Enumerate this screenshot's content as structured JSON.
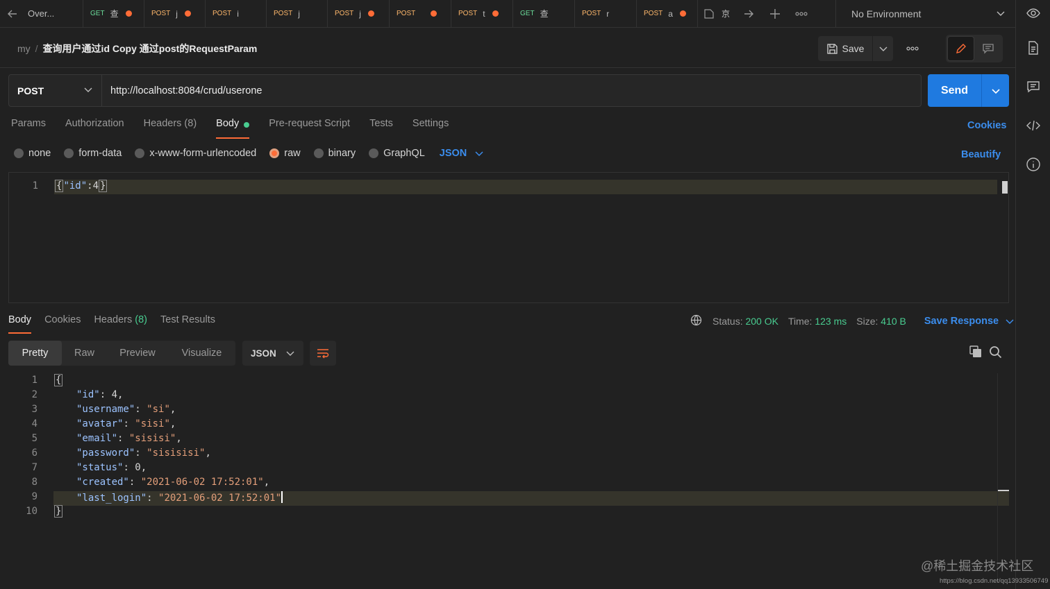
{
  "tabs": {
    "overview": "Over...",
    "items": [
      {
        "method": "GET",
        "name": "查",
        "dirty": true
      },
      {
        "method": "POST",
        "name": "j",
        "dirty": true
      },
      {
        "method": "POST",
        "name": "i",
        "dirty": false
      },
      {
        "method": "POST",
        "name": "j",
        "dirty": false
      },
      {
        "method": "POST",
        "name": "j",
        "dirty": true
      },
      {
        "method": "POST",
        "name": " ",
        "dirty": true
      },
      {
        "method": "POST",
        "name": "t",
        "dirty": true
      },
      {
        "method": "GET",
        "name": "查",
        "dirty": false
      },
      {
        "method": "POST",
        "name": "r",
        "dirty": false
      },
      {
        "method": "POST",
        "name": "a",
        "dirty": true
      }
    ],
    "open_tab_label": "京",
    "environment": "No Environment"
  },
  "header": {
    "workspace": "my",
    "separator": "/",
    "request_name": "查询用户通过id Copy 通过post的RequestParam",
    "save_label": "Save"
  },
  "request": {
    "method": "POST",
    "url": "http://localhost:8084/crud/userone",
    "send_label": "Send",
    "tabs": [
      {
        "label": "Params"
      },
      {
        "label": "Authorization"
      },
      {
        "label": "Headers",
        "count": "(8)"
      },
      {
        "label": "Body",
        "active": true
      },
      {
        "label": "Pre-request Script"
      },
      {
        "label": "Tests"
      },
      {
        "label": "Settings"
      }
    ],
    "cookies_label": "Cookies",
    "body_types": [
      "none",
      "form-data",
      "x-www-form-urlencoded",
      "raw",
      "binary",
      "GraphQL"
    ],
    "body_type_selected": "raw",
    "body_lang": "JSON",
    "beautify_label": "Beautify",
    "body_lines": [
      "{\"id\":4}"
    ]
  },
  "response": {
    "tabs": [
      {
        "label": "Body",
        "active": true
      },
      {
        "label": "Cookies"
      },
      {
        "label": "Headers",
        "count": "(8)"
      },
      {
        "label": "Test Results"
      }
    ],
    "status_label": "Status:",
    "status_value": "200 OK",
    "time_label": "Time:",
    "time_value": "123 ms",
    "size_label": "Size:",
    "size_value": "410 B",
    "save_response_label": "Save Response",
    "view_tabs": [
      "Pretty",
      "Raw",
      "Preview",
      "Visualize"
    ],
    "view_selected": "Pretty",
    "format": "JSON",
    "json": {
      "id": "4",
      "username": "si",
      "avatar": "sisi",
      "email": "sisisi",
      "password": "sisisisi",
      "status": "0",
      "created": "2021-06-02 17:52:01",
      "last_login": "2021-06-02 17:52:01"
    }
  },
  "watermark": {
    "text": "@稀土掘金技术社区",
    "url": "https://blog.csdn.net/qq13933506749"
  },
  "colors": {
    "accent": "#ff6c37",
    "primary": "#1f7ae0",
    "link": "#3b8ded",
    "success": "#49cc90"
  }
}
